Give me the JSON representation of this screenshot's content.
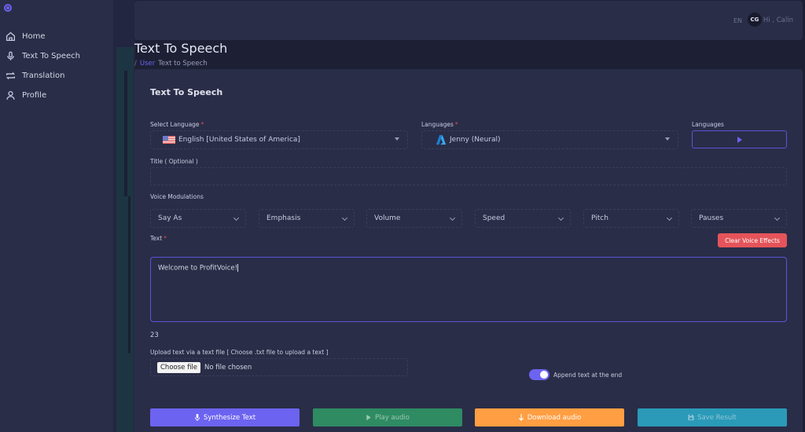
{
  "sidebar": {
    "logo_icon": "circle-logo-icon",
    "items": [
      {
        "label": "Home",
        "icon": "home-icon"
      },
      {
        "label": "Text To Speech",
        "icon": "microphone-icon"
      },
      {
        "label": "Translation",
        "icon": "repeat-icon"
      },
      {
        "label": "Profile",
        "icon": "user-icon"
      }
    ]
  },
  "topbar": {
    "language": "EN",
    "avatar_initials": "CG",
    "greeting": "Hi , Calin"
  },
  "page": {
    "title": "Text To Speech",
    "breadcrumb": {
      "separator": "/",
      "link": "User",
      "current": "Text to Speech"
    }
  },
  "form": {
    "card_title": "Text To Speech",
    "select_language": {
      "label": "Select Language",
      "required": "*",
      "value": "English [United States of America]",
      "flag": "us-flag-icon"
    },
    "voice": {
      "label": "Languages",
      "required": "*",
      "value": "Jenny (Neural)",
      "icon": "azure-icon"
    },
    "preview": {
      "label": "Languages",
      "icon": "play-icon"
    },
    "title_field": {
      "label": "Title ( Optional )",
      "value": ""
    },
    "modulations": {
      "label": "Voice Modulations",
      "options": [
        "Say As",
        "Emphasis",
        "Volume",
        "Speed",
        "Pitch",
        "Pauses"
      ]
    },
    "text": {
      "label": "Text",
      "required": "*",
      "value": "Welcome to ProfitVoice!",
      "char_count": "23"
    },
    "clear_button": "Clear Voice Effects",
    "upload": {
      "label": "Upload text via a text file [ Choose .txt file to upload a text ]",
      "button": "Choose file",
      "status": "No file chosen"
    },
    "append_toggle": {
      "label": "Append text at the end",
      "on": true
    }
  },
  "actions": {
    "synthesize": "Synthesize Text",
    "play": "Play audio",
    "download": "Download audio",
    "save": "Save Result"
  },
  "colors": {
    "accent": "#6c63f0",
    "danger": "#e5545a",
    "success": "#2e8b62",
    "warning": "#ff9e42",
    "info": "#2a9ab8"
  }
}
